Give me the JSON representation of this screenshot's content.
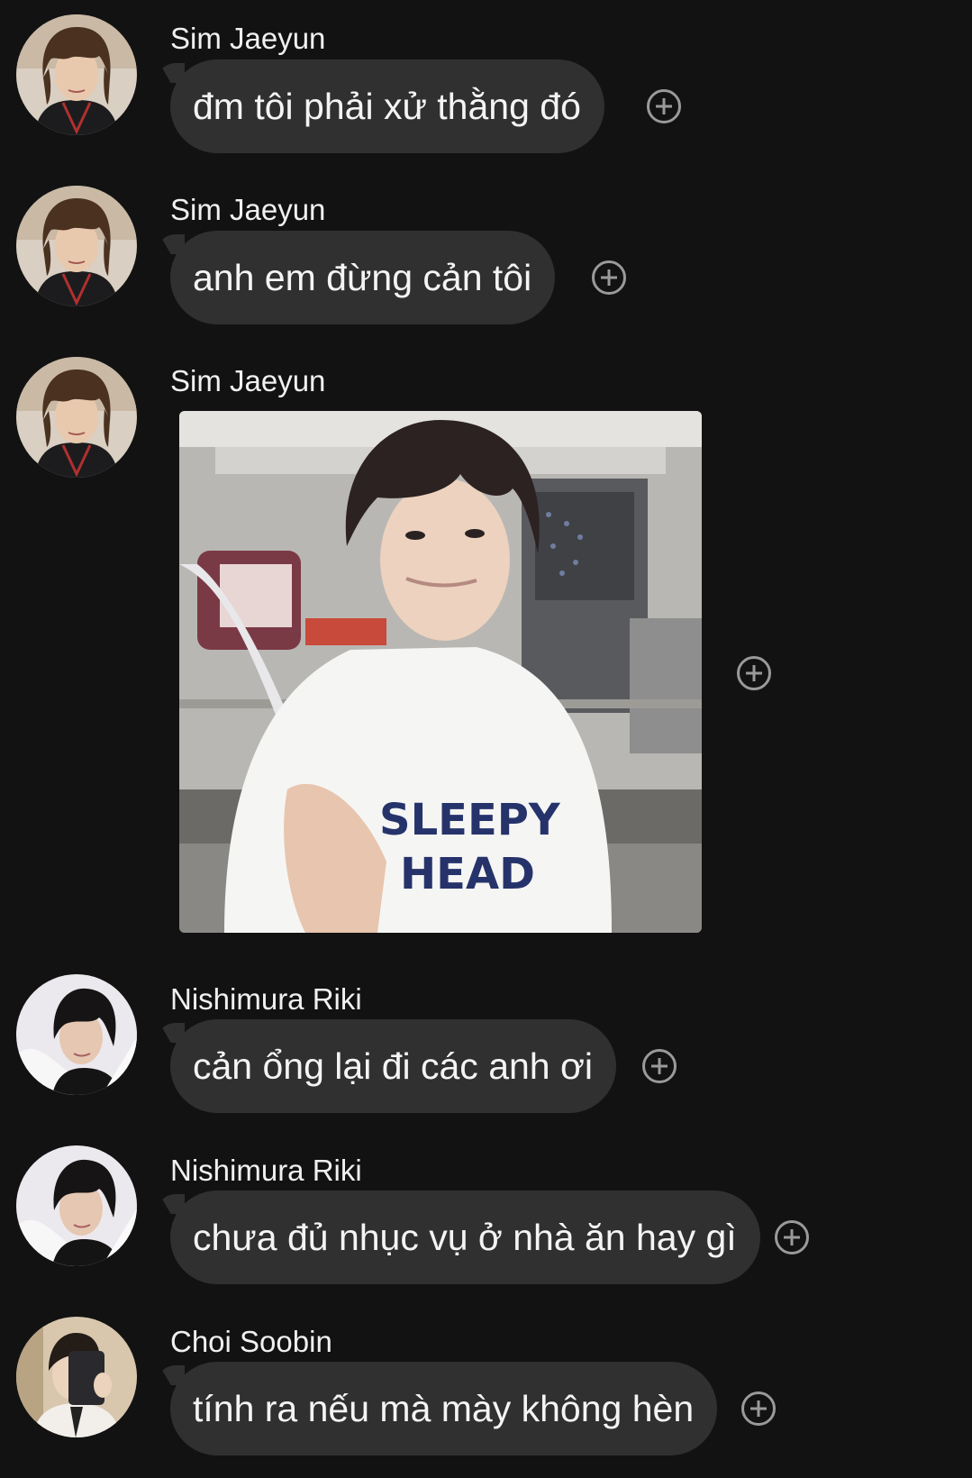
{
  "messages": [
    {
      "sender": "Sim Jaeyun",
      "text": "đm tôi phải xử thằng đó",
      "avatar": "avatar-jaeyun"
    },
    {
      "sender": "Sim Jaeyun",
      "text": "anh em đừng cản tôi",
      "avatar": "avatar-jaeyun"
    },
    {
      "sender": "Sim Jaeyun",
      "image_caption": "SLEEPY HEAD",
      "image_caption_line1": "SLEEPY",
      "image_caption_line2": "HEAD",
      "avatar": "avatar-jaeyun"
    },
    {
      "sender": "Nishimura Riki",
      "text": "cản ổng lại đi các anh ơi",
      "avatar": "avatar-riki"
    },
    {
      "sender": "Nishimura Riki",
      "text": "chưa đủ nhục vụ ở nhà ăn hay gì",
      "avatar": "avatar-riki"
    },
    {
      "sender": "Choi Soobin",
      "text": "tính ra nếu mà mày không hèn",
      "avatar": "avatar-soobin"
    }
  ],
  "icons": {
    "react": "add-reaction-icon"
  },
  "colors": {
    "background": "#121212",
    "bubble": "#303030",
    "text": "#f4f4f4",
    "icon": "#9a9a9a"
  }
}
